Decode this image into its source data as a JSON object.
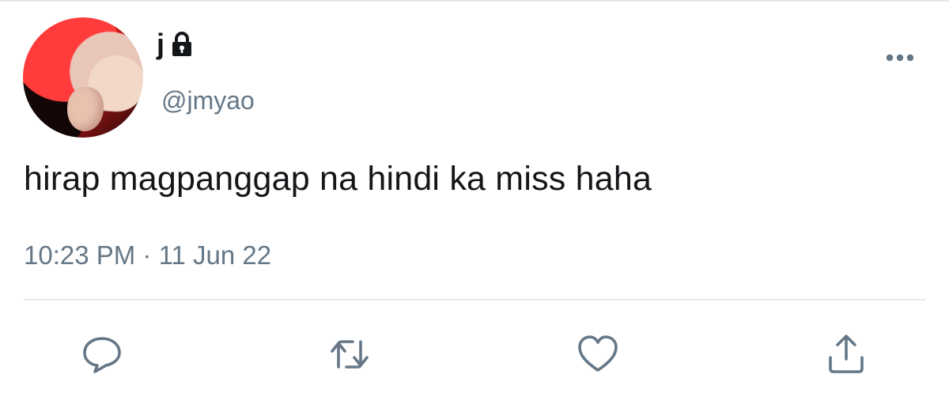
{
  "tweet": {
    "author": {
      "display_name": "j",
      "handle": "@jmyao",
      "protected_icon": "lock-icon"
    },
    "text": "hirap magpanggap na hindi ka miss haha",
    "timestamp": "10:23 PM · 11 Jun 22",
    "menu_icon": "more-horizontal-icon",
    "actions": [
      {
        "name": "reply",
        "icon": "reply-icon"
      },
      {
        "name": "retweet",
        "icon": "retweet-icon"
      },
      {
        "name": "like",
        "icon": "heart-icon"
      },
      {
        "name": "share",
        "icon": "share-icon"
      }
    ]
  },
  "colors": {
    "primary_text": "#14171a",
    "secondary_text": "#657786",
    "divider": "#e6e9ec",
    "icon": "#657786"
  }
}
